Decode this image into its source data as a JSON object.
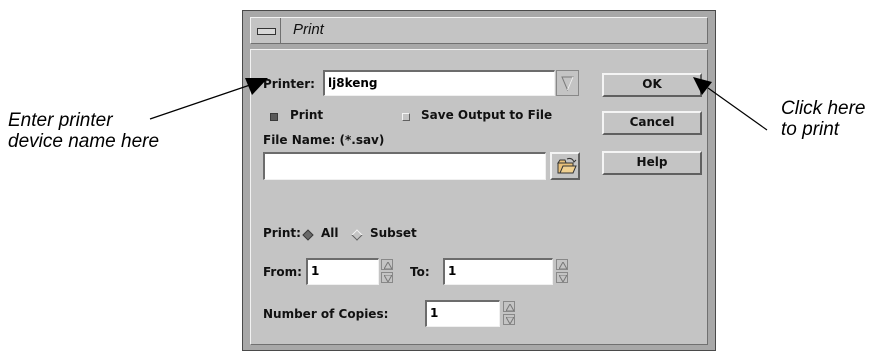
{
  "annotations": {
    "left_line1": "Enter printer",
    "left_line2": "device name here",
    "right_line1": "Click here",
    "right_line2": "to print"
  },
  "window": {
    "title": "Print"
  },
  "printer": {
    "label": "Printer:",
    "value": "lj8keng"
  },
  "output": {
    "print_label": "Print",
    "print_checked": true,
    "save_label": "Save Output to File",
    "save_checked": false
  },
  "file": {
    "label": "File Name: (*.sav)",
    "value": ""
  },
  "print_range": {
    "label": "Print:",
    "all_label": "All",
    "subset_label": "Subset",
    "selected": "All"
  },
  "range": {
    "from_label": "From:",
    "from_value": "1",
    "to_label": "To:",
    "to_value": "1"
  },
  "copies": {
    "label": "Number of Copies:",
    "value": "1"
  },
  "buttons": {
    "ok": "OK",
    "cancel": "Cancel",
    "help": "Help"
  }
}
